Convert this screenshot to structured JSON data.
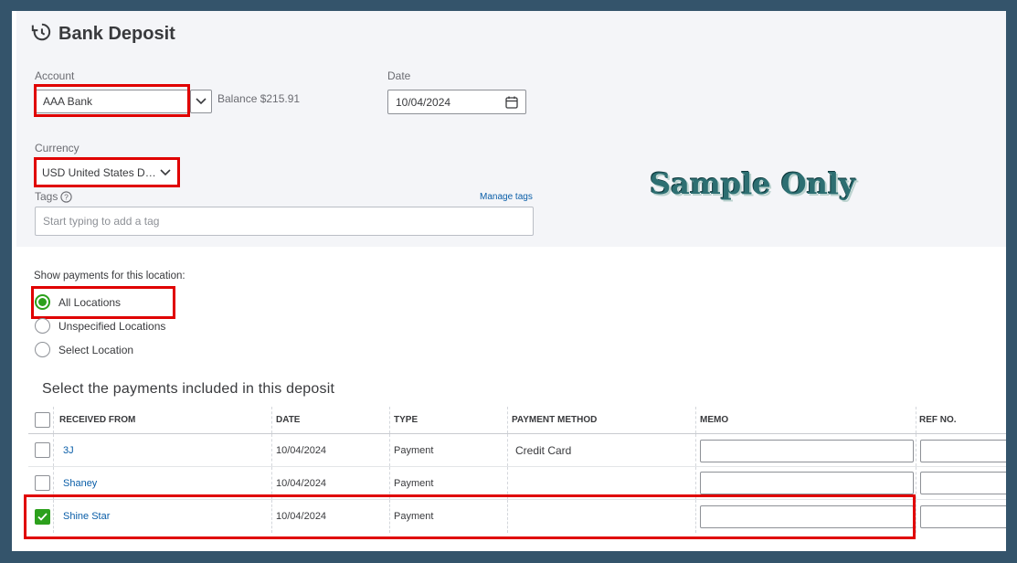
{
  "page": {
    "title": "Bank Deposit"
  },
  "account": {
    "label": "Account",
    "value": "AAA Bank",
    "balance": "Balance $215.91"
  },
  "date": {
    "label": "Date",
    "value": "10/04/2024"
  },
  "currency": {
    "label": "Currency",
    "value": "USD United States D…"
  },
  "tags": {
    "label": "Tags",
    "manage_label": "Manage tags",
    "placeholder": "Start typing to add a tag"
  },
  "watermark": "Sample Only",
  "location": {
    "label": "Show payments for this location:",
    "options": [
      {
        "label": "All Locations",
        "selected": true
      },
      {
        "label": "Unspecified Locations",
        "selected": false
      },
      {
        "label": "Select Location",
        "selected": false
      }
    ]
  },
  "payments": {
    "title": "Select the payments included in this deposit",
    "columns": [
      "RECEIVED FROM",
      "DATE",
      "TYPE",
      "PAYMENT METHOD",
      "MEMO",
      "REF NO."
    ],
    "rows": [
      {
        "received_from": "3J",
        "date": "10/04/2024",
        "type": "Payment",
        "method": "Credit Card",
        "checked": false
      },
      {
        "received_from": "Shaney",
        "date": "10/04/2024",
        "type": "Payment",
        "method": "",
        "checked": false
      },
      {
        "received_from": "Shine Star",
        "date": "10/04/2024",
        "type": "Payment",
        "method": "",
        "checked": true
      }
    ]
  },
  "colors": {
    "accent_green": "#2ca01c",
    "highlight_red": "#e00000",
    "link_blue": "#0a5ea8",
    "frame": "#34546b"
  },
  "icons": {
    "title": "history-icon",
    "calendar": "calendar-icon",
    "dropdown": "chevron-down-icon",
    "help": "help-circle-icon"
  }
}
